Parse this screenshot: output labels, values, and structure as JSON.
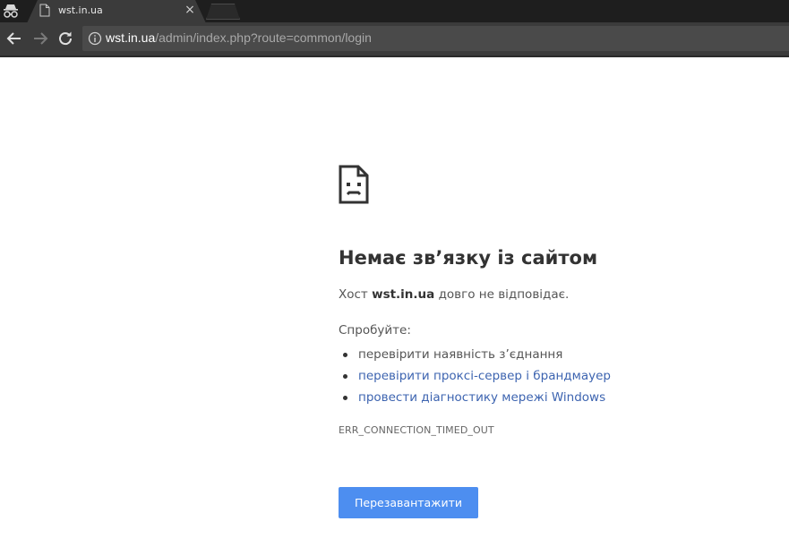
{
  "browser": {
    "tab_title": "wst.in.ua",
    "tab_close": "×",
    "url_host": "wst.in.ua",
    "url_path": "/admin/index.php?route=common/login"
  },
  "icons": {
    "incognito": "incognito-icon",
    "favicon": "page-icon",
    "back": "arrow-left-icon",
    "forward": "arrow-right-icon",
    "reload": "reload-icon",
    "info": "info-icon",
    "sad_page": "sad-page-icon"
  },
  "error": {
    "headline": "Немає зв’язку із сайтом",
    "summary_prefix": "Хост ",
    "summary_host": "wst.in.ua",
    "summary_suffix": " довго не відповідає.",
    "suggest_label": "Спробуйте:",
    "suggestions": [
      "перевірити наявність з’єднання",
      "перевірити проксі-сервер і брандмауер",
      "провести діагностику мережі Windows"
    ],
    "code": "ERR_CONNECTION_TIMED_OUT",
    "reload_label": "Перезавантажити"
  },
  "colors": {
    "button": "#4d8ef0",
    "link": "#3d64b0",
    "chrome_dark": "#1e1e1e",
    "chrome_toolbar": "#3b3b3b"
  }
}
